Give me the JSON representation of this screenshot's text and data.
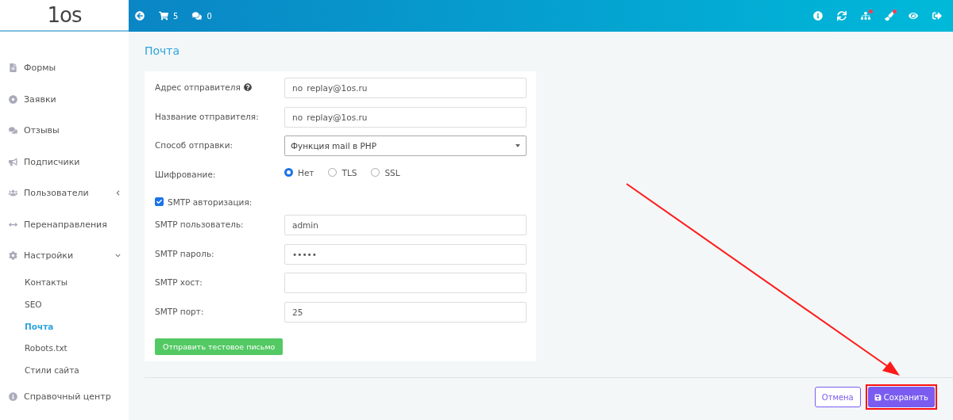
{
  "logo": {
    "text": "1os"
  },
  "header": {
    "left": [
      {
        "kind": "back"
      },
      {
        "kind": "cart",
        "count": "5"
      },
      {
        "kind": "comments",
        "count": "0"
      }
    ],
    "right": [
      {
        "kind": "info",
        "dot": false
      },
      {
        "kind": "sync",
        "dot": false
      },
      {
        "kind": "sitemap",
        "dot": true
      },
      {
        "kind": "brush",
        "dot": true
      },
      {
        "kind": "eye",
        "dot": false
      },
      {
        "kind": "logout",
        "dot": false
      }
    ]
  },
  "sidebar": {
    "items": [
      {
        "label": "Формы",
        "kind": "file",
        "selected": false
      },
      {
        "label": "Заявки",
        "kind": "target",
        "selected": false
      },
      {
        "label": "Отзывы",
        "kind": "comments",
        "selected": false
      },
      {
        "label": "Подписчики",
        "kind": "bullhorn",
        "selected": false
      },
      {
        "label": "Пользователи",
        "kind": "users",
        "selected": false,
        "expanded": false
      },
      {
        "label": "Перенаправления",
        "kind": "arrows",
        "selected": false
      },
      {
        "label": "Настройки",
        "kind": "cog",
        "selected": false,
        "expanded": true,
        "children": [
          {
            "label": "Контакты",
            "selected": false
          },
          {
            "label": "SEO",
            "selected": false
          },
          {
            "label": "Почта",
            "selected": true
          },
          {
            "label": "Robots.txt",
            "selected": false
          },
          {
            "label": "Стили сайта",
            "selected": false
          }
        ]
      },
      {
        "label": "Справочный центр",
        "kind": "info",
        "selected": false
      }
    ]
  },
  "page": {
    "title": "Почта"
  },
  "form": {
    "fields": [
      {
        "kind": "text",
        "label": "Адрес отправителя",
        "help": true,
        "value": "no_replay@1os.ru"
      },
      {
        "kind": "text",
        "label": "Название отправителя:",
        "value": "no_replay@1os.ru"
      },
      {
        "kind": "select",
        "label": "Способ отправки:",
        "value": "Функция mail в PHP"
      },
      {
        "kind": "radio",
        "label": "Шифрование:",
        "options": [
          {
            "label": "Нет",
            "selected": true
          },
          {
            "label": "TLS",
            "selected": false
          },
          {
            "label": "SSL",
            "selected": false
          }
        ]
      },
      {
        "kind": "checkbox",
        "label": "SMTP авторизация:",
        "checked": true
      },
      {
        "kind": "text",
        "label": "SMTP пользователь:",
        "value": "admin"
      },
      {
        "kind": "text",
        "label": "SMTP пароль:",
        "value": "•••••"
      },
      {
        "kind": "text",
        "label": "SMTP хост:"
      },
      {
        "kind": "text",
        "label": "SMTP порт:",
        "value": "25"
      }
    ],
    "test_button": "Отправить тестовое письмо"
  },
  "footer": {
    "cancel": "Отмена",
    "save": "Сохранить",
    "save_highlighted": true
  }
}
